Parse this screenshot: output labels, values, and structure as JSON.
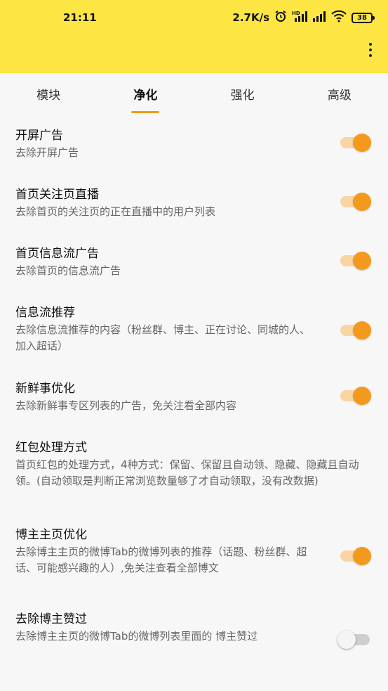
{
  "status": {
    "time": "21:11",
    "net_speed": "2.7K/s",
    "battery": "38"
  },
  "tabs": [
    {
      "label": "模块",
      "active": false
    },
    {
      "label": "净化",
      "active": true
    },
    {
      "label": "强化",
      "active": false
    },
    {
      "label": "高级",
      "active": false
    }
  ],
  "settings": [
    {
      "title": "开屏广告",
      "desc": "去除开屏广告",
      "enabled": true
    },
    {
      "title": "首页关注页直播",
      "desc": "去除首页的关注页的正在直播中的用户列表",
      "enabled": true
    },
    {
      "title": "首页信息流广告",
      "desc": "去除首页的信息流广告",
      "enabled": true
    },
    {
      "title": "信息流推荐",
      "desc": "去除信息流推荐的内容（粉丝群、博主、正在讨论、同城的人、加入超话）",
      "enabled": true
    },
    {
      "title": "新鲜事优化",
      "desc": "去除新鲜事专区列表的广告，免关注看全部内容",
      "enabled": true
    },
    {
      "title": "红包处理方式",
      "desc": "首页红包的处理方式，4种方式：保留、保留且自动领、隐藏、隐藏且自动领。(自动领取是判断正常浏览数量够了才自动领取，没有改数据)"
    },
    {
      "title": "博主主页优化",
      "desc": "去除博主主页的微博Tab的微博列表的推荐（话题、粉丝群、超话、可能感兴趣的人）,免关注查看全部博文",
      "enabled": true
    },
    {
      "title": "去除博主赞过",
      "desc": "去除博主主页的微博Tab的微博列表里面的 博主赞过",
      "enabled": false
    }
  ],
  "colors": {
    "appbar": "#fde643",
    "accent": "#f39a1e"
  }
}
